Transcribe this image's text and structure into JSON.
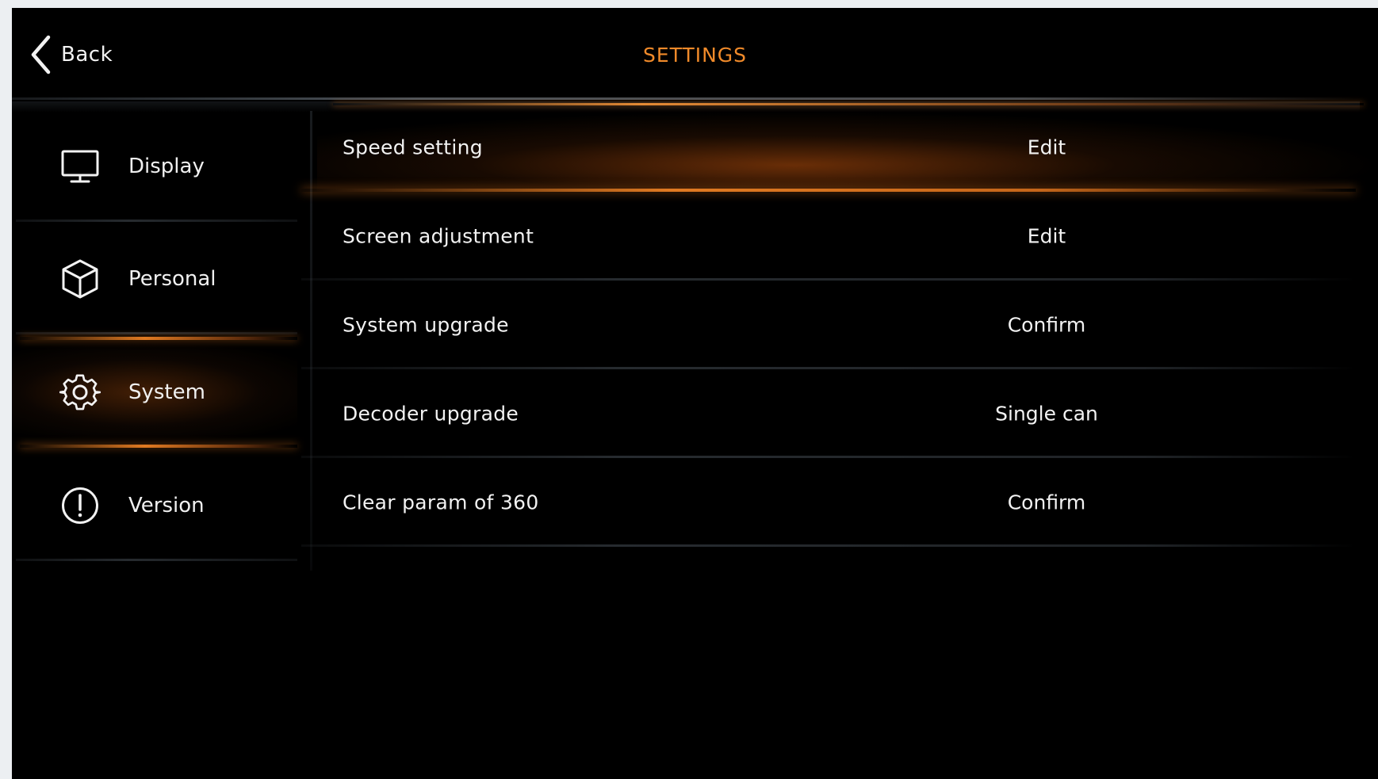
{
  "header": {
    "back_label": "Back",
    "title": "SETTINGS"
  },
  "sidebar": {
    "items": [
      {
        "label": "Display",
        "icon": "monitor-icon",
        "active": false
      },
      {
        "label": "Personal",
        "icon": "cube-icon",
        "active": false
      },
      {
        "label": "System",
        "icon": "gear-icon",
        "active": true
      },
      {
        "label": "Version",
        "icon": "info-icon",
        "active": false
      }
    ]
  },
  "settings": {
    "rows": [
      {
        "label": "Speed setting",
        "action": "Edit",
        "active": true
      },
      {
        "label": "Screen adjustment",
        "action": "Edit",
        "active": false
      },
      {
        "label": "System upgrade",
        "action": "Confirm",
        "active": false
      },
      {
        "label": "Decoder upgrade",
        "action": "Single can",
        "active": false
      },
      {
        "label": "Clear param of 360",
        "action": "Confirm",
        "active": false
      }
    ]
  },
  "colors": {
    "accent": "#f08a2a",
    "background": "#000000",
    "text": "#f2f2f2"
  }
}
